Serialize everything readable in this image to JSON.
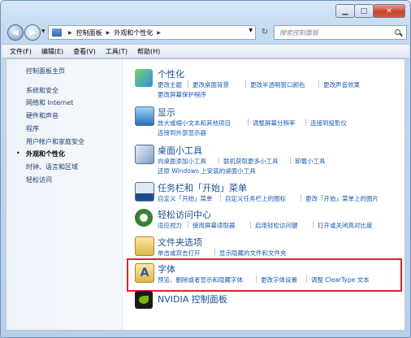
{
  "window": {
    "minimize": "▁",
    "maximize": "□",
    "close": "✕"
  },
  "nav": {
    "back_arrow": "◀",
    "forward_arrow": "▶",
    "refresh": "↻",
    "history": "▼"
  },
  "address": {
    "crumbs": [
      "控制面板",
      "外观和个性化"
    ],
    "separator": "▶"
  },
  "search": {
    "placeholder": "搜索控制面板"
  },
  "menubar": {
    "items": [
      "文件(F)",
      "编辑(E)",
      "查看(V)",
      "工具(T)",
      "帮助(H)"
    ]
  },
  "left_nav": {
    "items": [
      "控制面板主页",
      "系统和安全",
      "网络和 Internet",
      "硬件和声音",
      "程序",
      "用户帐户和家庭安全",
      "外观和个性化",
      "时钟、语言和区域",
      "轻松访问"
    ],
    "current_index": 6,
    "bullet": "•"
  },
  "categories": [
    {
      "title": "个性化",
      "links1": [
        "更改主题",
        "更改桌面背景",
        "更改半透明窗口颜色",
        "更改声音效果"
      ],
      "links2": [
        "更改屏幕保护程序"
      ]
    },
    {
      "title": "显示",
      "links1": [
        "放大或缩小文本和其他项目",
        "调整屏幕分辨率",
        "连接到投影仪"
      ],
      "links2": [
        "连接到外部显示器"
      ]
    },
    {
      "title": "桌面小工具",
      "links1": [
        "向桌面添加小工具",
        "联机获取更多小工具",
        "卸载小工具"
      ],
      "links2": [
        "还原 Windows 上安装的桌面小工具"
      ]
    },
    {
      "title": "任务栏和「开始」菜单",
      "links1": [
        "自定义「开始」菜单",
        "自定义任务栏上的图标",
        "更改「开始」菜单上的图片"
      ],
      "links2": []
    },
    {
      "title": "轻松访问中心",
      "links1": [
        "适应视力",
        "使用屏幕读取器",
        "启用轻松访问键",
        "打开或关闭高对比度"
      ],
      "links2": []
    },
    {
      "title": "文件夹选项",
      "links1": [
        "单击或双击打开",
        "显示隐藏的文件和文件夹"
      ],
      "links2": []
    },
    {
      "title": "字体",
      "links1": [
        "预览、删除或者显示和隐藏字体",
        "更改字体设置",
        "调整 ClearType 文本"
      ],
      "links2": []
    },
    {
      "title": "NVIDIA 控制面板",
      "links1": [],
      "links2": []
    }
  ],
  "colors": {
    "link": "#1b5bb5",
    "title": "#1a4f9c",
    "highlight": "#e4212a"
  }
}
